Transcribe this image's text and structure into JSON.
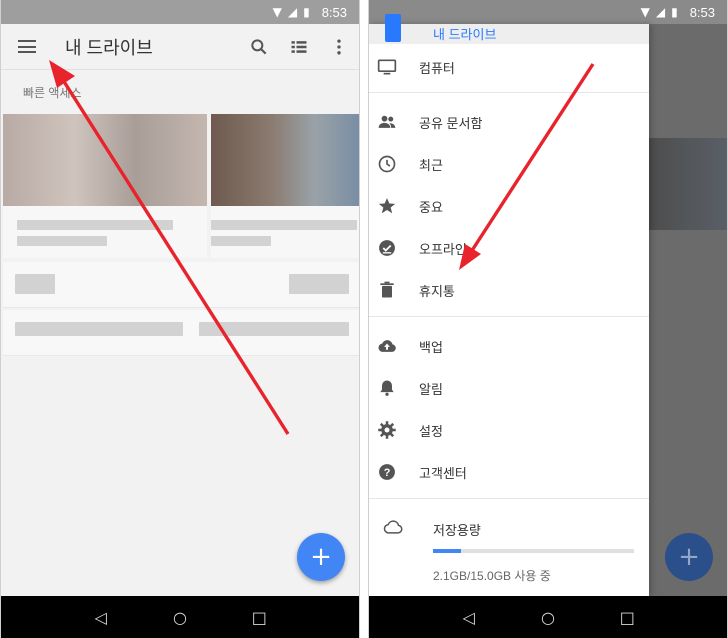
{
  "status_bar": {
    "time": "8:53"
  },
  "left_screen": {
    "app_bar": {
      "title": "내 드라이브"
    },
    "quick_access_label": "빠른 액세스",
    "fab_label": "+"
  },
  "right_screen": {
    "drawer": {
      "top_item": "내 드라이브",
      "items_group1": [
        {
          "label": "컴퓨터",
          "icon": "computer-icon"
        }
      ],
      "items_group2": [
        {
          "label": "공유 문서함",
          "icon": "people-icon"
        },
        {
          "label": "최근",
          "icon": "clock-icon"
        },
        {
          "label": "중요",
          "icon": "star-icon"
        },
        {
          "label": "오프라인",
          "icon": "offline-icon"
        },
        {
          "label": "휴지통",
          "icon": "trash-icon"
        }
      ],
      "items_group3": [
        {
          "label": "백업",
          "icon": "cloud-upload-icon"
        },
        {
          "label": "알림",
          "icon": "bell-icon"
        },
        {
          "label": "설정",
          "icon": "gear-icon"
        },
        {
          "label": "고객센터",
          "icon": "help-icon"
        }
      ],
      "storage": {
        "label": "저장용량",
        "usage_text": "2.1GB/15.0GB 사용 중",
        "used_fraction": 0.14
      }
    },
    "fab_label": "+"
  },
  "colors": {
    "accent": "#4285f4",
    "annotation_arrow": "#e8232b",
    "status_bar": "#9e9e9e"
  }
}
